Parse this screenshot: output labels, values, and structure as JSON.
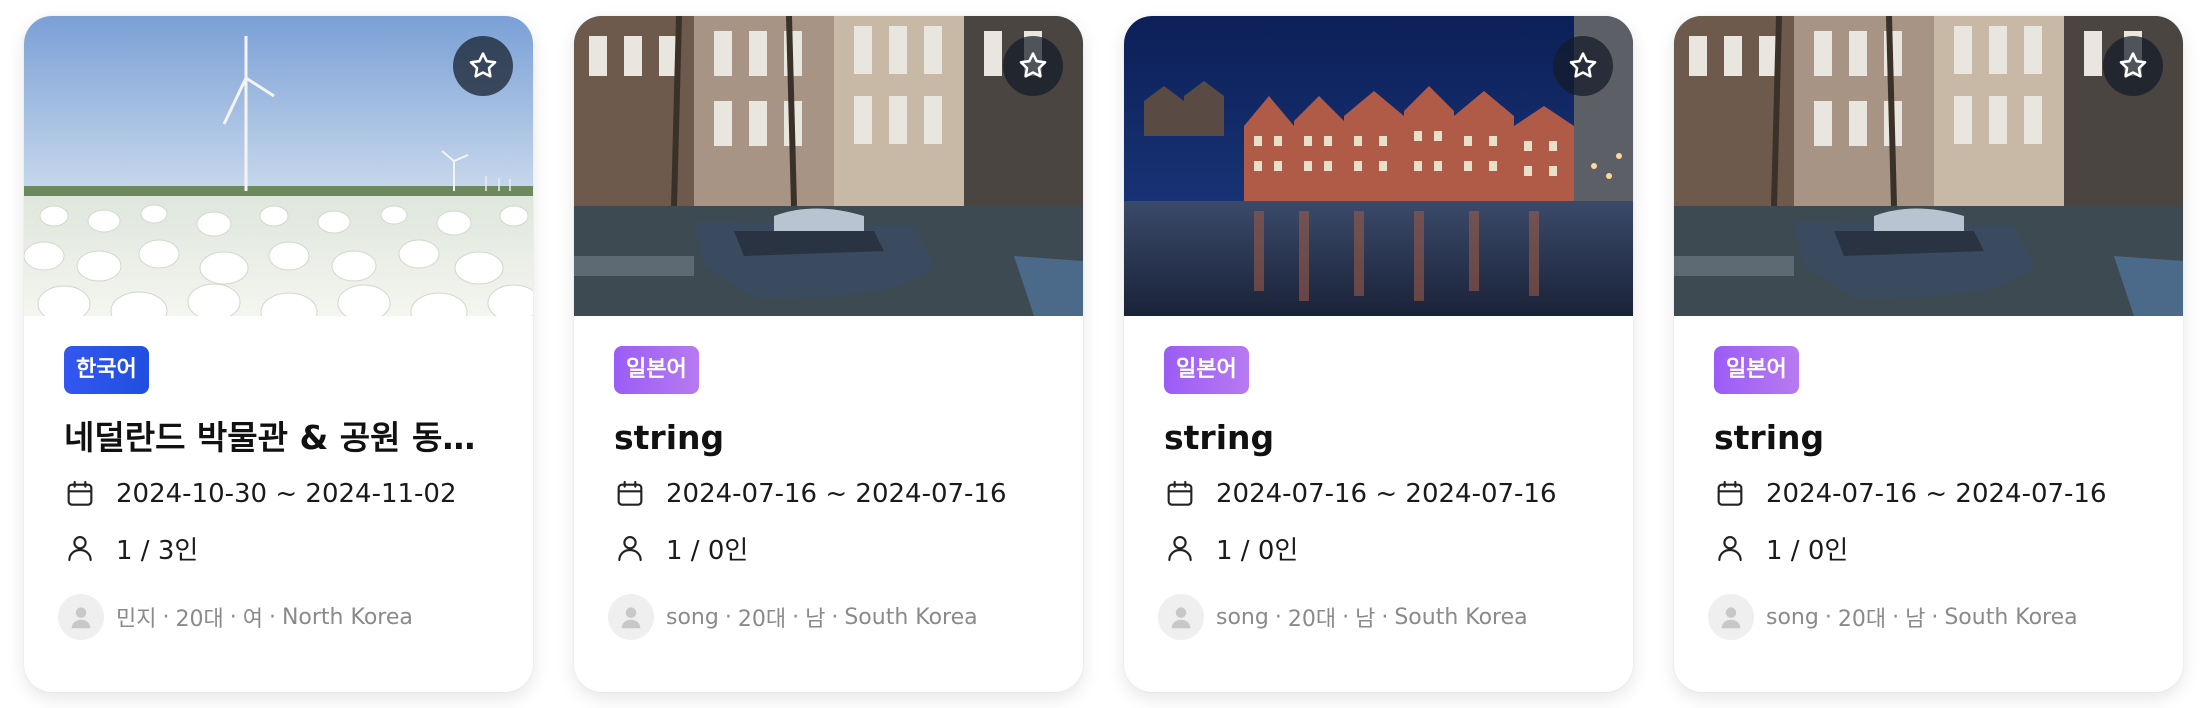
{
  "cards": [
    {
      "language": "한국어",
      "title": "네덜란드 박물관 & 공원 동행 구해요",
      "dates": "2024-10-30 ~ 2024-11-02",
      "participants": "1 / 3인",
      "host": {
        "name": "민지",
        "age": "20대",
        "gender": "여",
        "country": "North Korea"
      },
      "image": "tulip-field-windmill"
    },
    {
      "language": "일본어",
      "title": "string",
      "dates": "2024-07-16 ~ 2024-07-16",
      "participants": "1 / 0인",
      "host": {
        "name": "song",
        "age": "20대",
        "gender": "남",
        "country": "South Korea"
      },
      "image": "amsterdam-canal-boat"
    },
    {
      "language": "일본어",
      "title": "string",
      "dates": "2024-07-16 ~ 2024-07-16",
      "participants": "1 / 0인",
      "host": {
        "name": "song",
        "age": "20대",
        "gender": "남",
        "country": "South Korea"
      },
      "image": "canal-houses-night"
    },
    {
      "language": "일본어",
      "title": "string",
      "dates": "2024-07-16 ~ 2024-07-16",
      "participants": "1 / 0인",
      "host": {
        "name": "song",
        "age": "20대",
        "gender": "남",
        "country": "South Korea"
      },
      "image": "amsterdam-canal-boat"
    }
  ],
  "icons": {
    "favorite": "star-icon",
    "date": "calendar-icon",
    "participants": "person-icon",
    "avatar": "user-avatar-icon"
  },
  "colors": {
    "badge_korean": "#2f55ee",
    "badge_japanese": "#a768f3",
    "favorite_bg": "#1c2430"
  }
}
